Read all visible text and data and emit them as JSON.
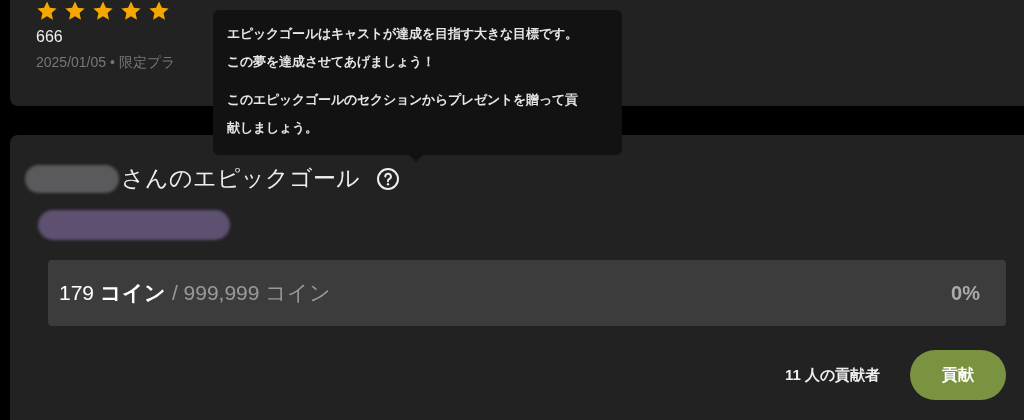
{
  "review": {
    "stars": 5,
    "count": "666",
    "meta": "2025/01/05 • 限定プラ"
  },
  "tooltip": {
    "paragraphs": [
      "エピックゴールはキャストが達成を目指す大きな目標です。この夢を達成させてあげましょう！",
      "このエピックゴールのセクションからプレゼントを贈って貢献しましょう。"
    ]
  },
  "epic_goal": {
    "title": "さんのエピックゴール",
    "current": "179 **コイン**",
    "target": "/ 999,999 コイン",
    "level": 0,
    "percent": "0%",
    "contributors": "11 人の貢献者",
    "button": "貢献"
  }
}
